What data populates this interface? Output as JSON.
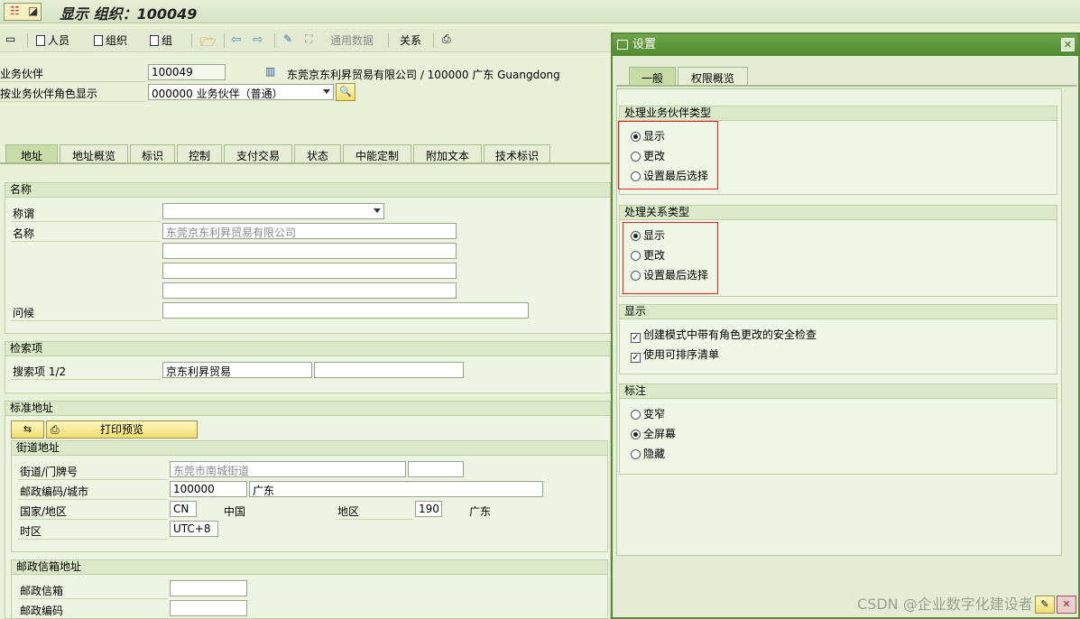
{
  "window": {
    "title": "显示 组织：100049"
  },
  "toolbar": {
    "person": "人员",
    "organization": "组织",
    "group": "组",
    "general_data": "通用数据",
    "relations": "关系"
  },
  "header": {
    "bp_label": "业务伙伴",
    "bp_value": "100049",
    "bp_desc": "东莞京东利昇贸易有限公司 / 100000 广东 Guangdong",
    "role_label": "按业务伙伴角色显示",
    "role_value": "000000 业务伙伴（普通）"
  },
  "tabs": [
    "地址",
    "地址概览",
    "标识",
    "控制",
    "支付交易",
    "状态",
    "中能定制",
    "附加文本",
    "技术标识"
  ],
  "name_section": {
    "title": "名称",
    "salutation_label": "称谓",
    "name_label": "名称",
    "name_value": "东莞京东利昇贸易有限公司",
    "greeting_label": "问候"
  },
  "search_section": {
    "title": "检索项",
    "label": "搜索项 1/2",
    "value1": "京东利昇贸易"
  },
  "address_section": {
    "title": "标准地址",
    "print_preview": "打印预览",
    "street_group": "街道地址",
    "street_label": "街道/门牌号",
    "street_value": "东莞市南城街道",
    "postal_label": "邮政编码/城市",
    "postal_value": "100000",
    "city_value": "广东",
    "country_label": "国家/地区",
    "country_code": "CN",
    "country_name": "中国",
    "region_label": "地区",
    "region_code": "190",
    "region_name": "广东",
    "timezone_label": "时区",
    "timezone_value": "UTC+8",
    "pobox_group": "邮政信箱地址",
    "pobox_label": "邮政信箱",
    "pobox_postal_label": "邮政编码"
  },
  "dialog": {
    "title": "设置",
    "tabs": [
      "一般",
      "权限概览"
    ],
    "bp_type_group": "处理业务伙伴类型",
    "bp_type_options": [
      "显示",
      "更改",
      "设置最后选择"
    ],
    "bp_type_selected": 0,
    "rel_type_group": "处理关系类型",
    "rel_type_options": [
      "显示",
      "更改",
      "设置最后选择"
    ],
    "rel_type_selected": 0,
    "display_group": "显示",
    "display_checks": [
      "创建模式中带有角色更改的安全检查",
      "使用可排序清单"
    ],
    "label_group": "标注",
    "label_options": [
      "变窄",
      "全屏幕",
      "隐藏"
    ],
    "label_selected": 1
  },
  "watermark": "CSDN @企业数字化建设者"
}
